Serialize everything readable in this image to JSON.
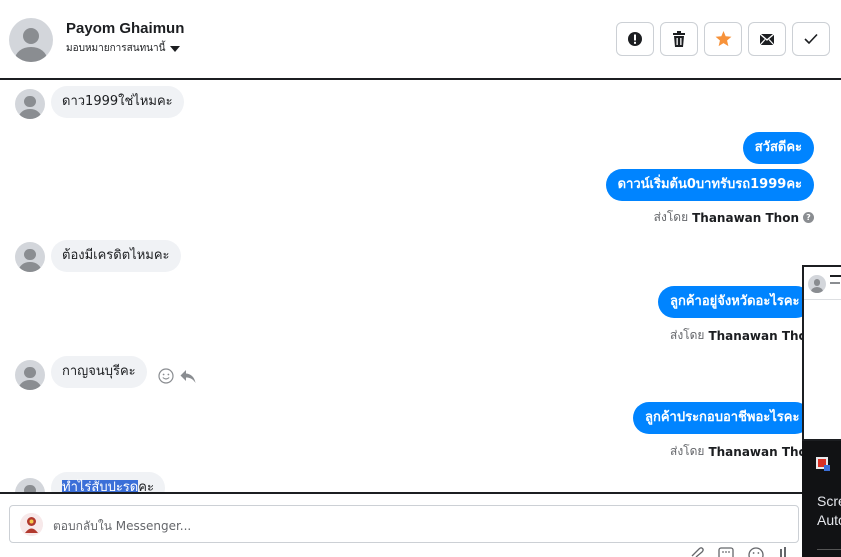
{
  "header": {
    "name": "Payom Ghaimun",
    "assign_label": "มอบหมายการสนทนานี้",
    "actions": [
      "mark-spam",
      "delete",
      "star",
      "mark-unread",
      "done"
    ]
  },
  "conversation": {
    "messages": [
      {
        "direction": "in",
        "text": "ดาว1999ใช่ไหมคะ"
      },
      {
        "direction": "out",
        "text": "สวัสดีคะ"
      },
      {
        "direction": "out",
        "text": "ดาวน์เริ่มต้น0บาทรับรถ1999คะ"
      },
      {
        "direction": "meta",
        "prefix": "ส่งโดย",
        "sender": "Thanawan Thon"
      },
      {
        "direction": "in",
        "text": "ต้องมีเครดิตไหมคะ"
      },
      {
        "direction": "out",
        "text": "ลูกค้าอยู่จังหวัดอะไรคะ"
      },
      {
        "direction": "meta",
        "prefix": "ส่งโดย",
        "sender": "Thanawan Thon"
      },
      {
        "direction": "in",
        "text": "กาญจนบุรีคะ"
      },
      {
        "direction": "out",
        "text": "ลูกค้าประกอบอาชีพอะไรคะ"
      },
      {
        "direction": "meta",
        "prefix": "ส่งโดย",
        "sender": "Thanawan Thon"
      },
      {
        "direction": "in",
        "text_selected": "ทำไร่สับปะรด",
        "text_rest": "คะ"
      }
    ]
  },
  "side_panel": {
    "line1": "Scre",
    "line2": "Auto"
  },
  "reply": {
    "placeholder": "ตอบกลับใน Messenger..."
  },
  "colors": {
    "outgoing_bubble": "#0084ff",
    "incoming_bubble": "#f0f2f5",
    "star": "#f7923a",
    "selection": "#3b6fd8"
  }
}
